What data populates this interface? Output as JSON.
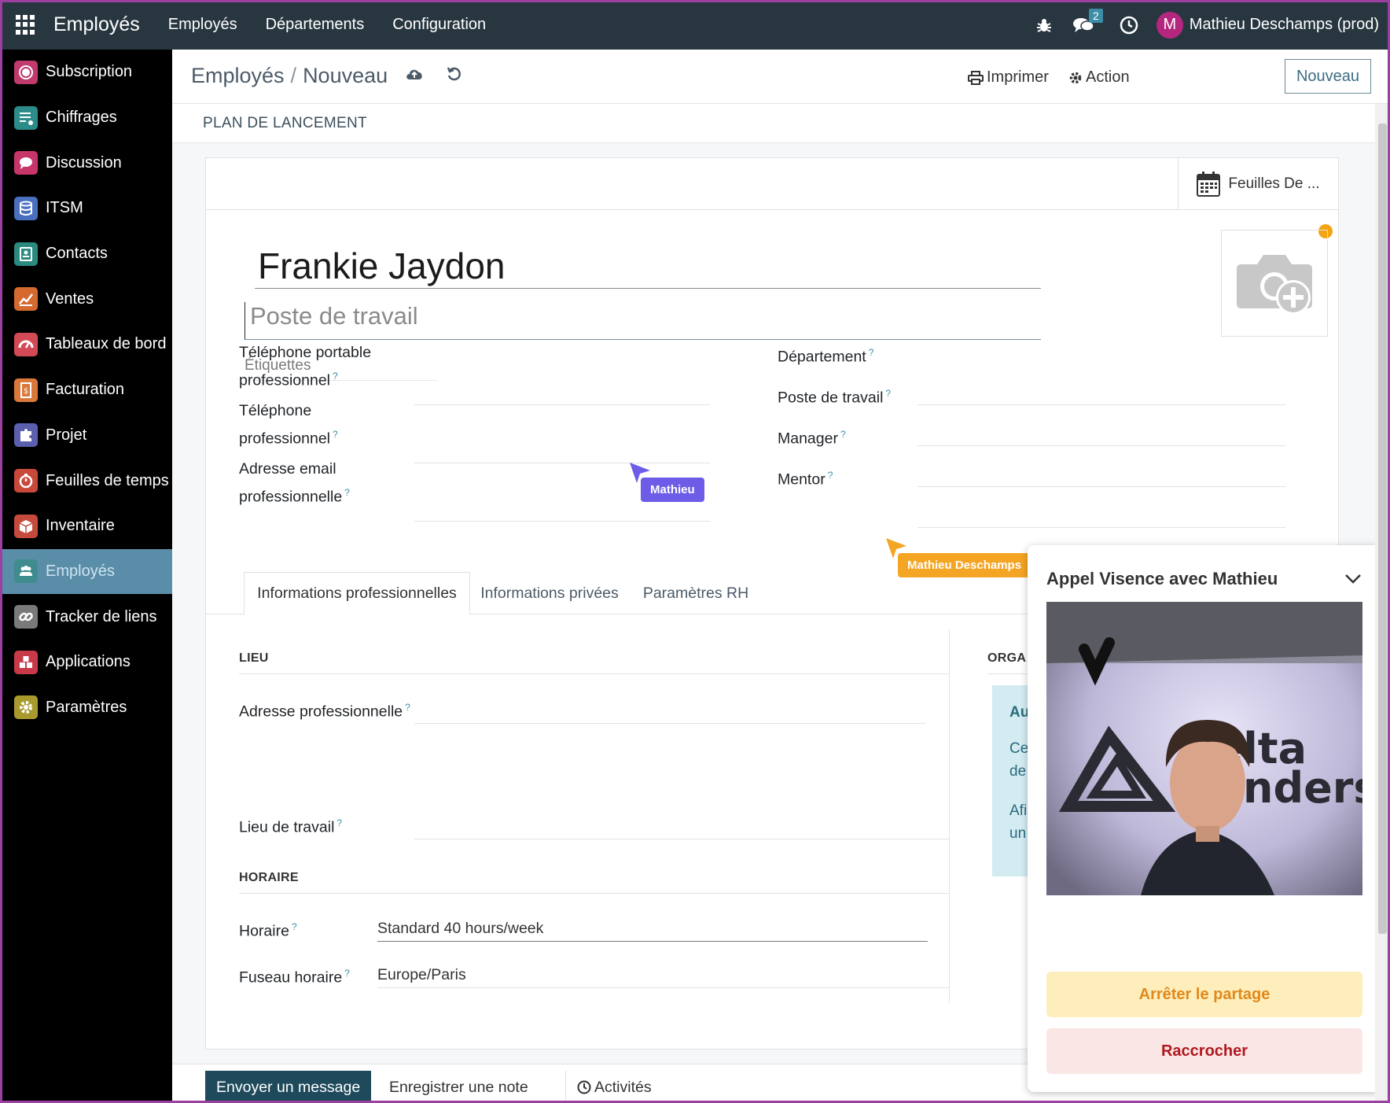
{
  "topbar": {
    "app_name": "Employés",
    "menu": [
      "Employés",
      "Départements",
      "Configuration"
    ],
    "chat_badge": "2",
    "avatar_letter": "M",
    "user_name": "Mathieu Deschamps (prod)"
  },
  "sidebar": {
    "items": [
      {
        "label": "Subscription",
        "icon": "subscription-icon",
        "color": "#c03a6d"
      },
      {
        "label": "Chiffrages",
        "icon": "quotation-icon",
        "color": "#2b8c8a"
      },
      {
        "label": "Discussion",
        "icon": "chat-icon",
        "color": "#c8356b"
      },
      {
        "label": "ITSM",
        "icon": "database-icon",
        "color": "#4a6fbf"
      },
      {
        "label": "Contacts",
        "icon": "contact-card-icon",
        "color": "#2a8a80"
      },
      {
        "label": "Ventes",
        "icon": "sales-chart-icon",
        "color": "#d46a2f"
      },
      {
        "label": "Tableaux de bord",
        "icon": "dashboard-gauge-icon",
        "color": "#d24a55"
      },
      {
        "label": "Facturation",
        "icon": "invoice-icon",
        "color": "#d9783a"
      },
      {
        "label": "Projet",
        "icon": "puzzle-icon",
        "color": "#5b5fae"
      },
      {
        "label": "Feuilles de temps",
        "icon": "stopwatch-icon",
        "color": "#c8493a"
      },
      {
        "label": "Inventaire",
        "icon": "box-icon",
        "color": "#c54a3c"
      },
      {
        "label": "Employés",
        "icon": "people-icon",
        "color": "#3e8c8e"
      },
      {
        "label": "Tracker de liens",
        "icon": "link-icon",
        "color": "#7a7a7a"
      },
      {
        "label": "Applications",
        "icon": "cubes-icon",
        "color": "#c83a4a"
      },
      {
        "label": "Paramètres",
        "icon": "gear-icon",
        "color": "#a99a2e"
      }
    ],
    "active_index": 11
  },
  "control": {
    "breadcrumb_parent": "Employés",
    "breadcrumb_sep": "/",
    "breadcrumb_current": "Nouveau",
    "print_label": "Imprimer",
    "action_label": "Action",
    "new_label": "Nouveau"
  },
  "statusbar": {
    "plan_label": "PLAN DE LANCEMENT"
  },
  "form": {
    "smart_button": "Feuilles De ...",
    "employee_name": "Frankie Jaydon",
    "job_title_placeholder": "Poste de travail",
    "tags_placeholder": "Étiquettes",
    "left_fields": [
      {
        "line1": "Téléphone portable",
        "line2": "professionnel"
      },
      {
        "line1": "Téléphone",
        "line2": "professionnel"
      },
      {
        "line1": "Adresse email",
        "line2": "professionnelle"
      }
    ],
    "right_fields": [
      "Département",
      "Poste de travail",
      "Manager",
      "Mentor"
    ],
    "help_mark": "?",
    "tabs": [
      "Informations professionnelles",
      "Informations privées",
      "Paramètres RH"
    ],
    "section_lieu": "LIEU",
    "section_orga": "ORGA",
    "work_address_label": "Adresse professionnelle",
    "work_location_label": "Lieu de travail",
    "section_horaire": "HORAIRE",
    "schedule_label": "Horaire",
    "schedule_value": "Standard 40 hours/week",
    "timezone_label": "Fuseau horaire",
    "timezone_value": "Europe/Paris",
    "alert_lines": [
      "Au",
      "Ce",
      "de",
      "Afi",
      "un"
    ]
  },
  "cursors": {
    "mathieu": {
      "label": "Mathieu",
      "color": "#6c5ce7"
    },
    "deschamps": {
      "label": "Mathieu Deschamps",
      "color": "#f5a524"
    }
  },
  "chatter": {
    "send_message": "Envoyer un message",
    "log_note": "Enregistrer une note",
    "activities": "Activités"
  },
  "call": {
    "title": "Appel Visence avec Mathieu",
    "stop_share": "Arrêter le partage",
    "hang_up": "Raccrocher"
  }
}
